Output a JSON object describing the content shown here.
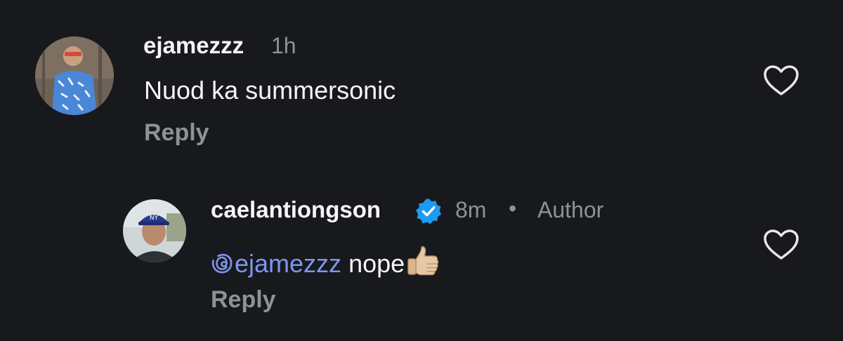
{
  "comments": [
    {
      "username": "ejamezzz",
      "time": "1h",
      "text": "Nuod ka summersonic",
      "reply_label": "Reply",
      "avatar_icon": "user-avatar",
      "like_icon": "heart-outline-icon"
    },
    {
      "username": "caelantiongson",
      "verified": true,
      "verified_icon": "verified-badge-icon",
      "time": "8m",
      "separator": "•",
      "role": "Author",
      "mention": "ejamezzz",
      "mention_icon": "threads-icon",
      "text": " nope",
      "emoji": "thumbs-up-emoji",
      "reply_label": "Reply",
      "avatar_icon": "user-avatar",
      "like_icon": "heart-outline-icon"
    }
  ],
  "colors": {
    "background": "#17191c",
    "primary_text": "#f5f5f5",
    "secondary_text": "#8e9196",
    "mention": "#7f95f0",
    "verified": "#1d9bf0"
  }
}
